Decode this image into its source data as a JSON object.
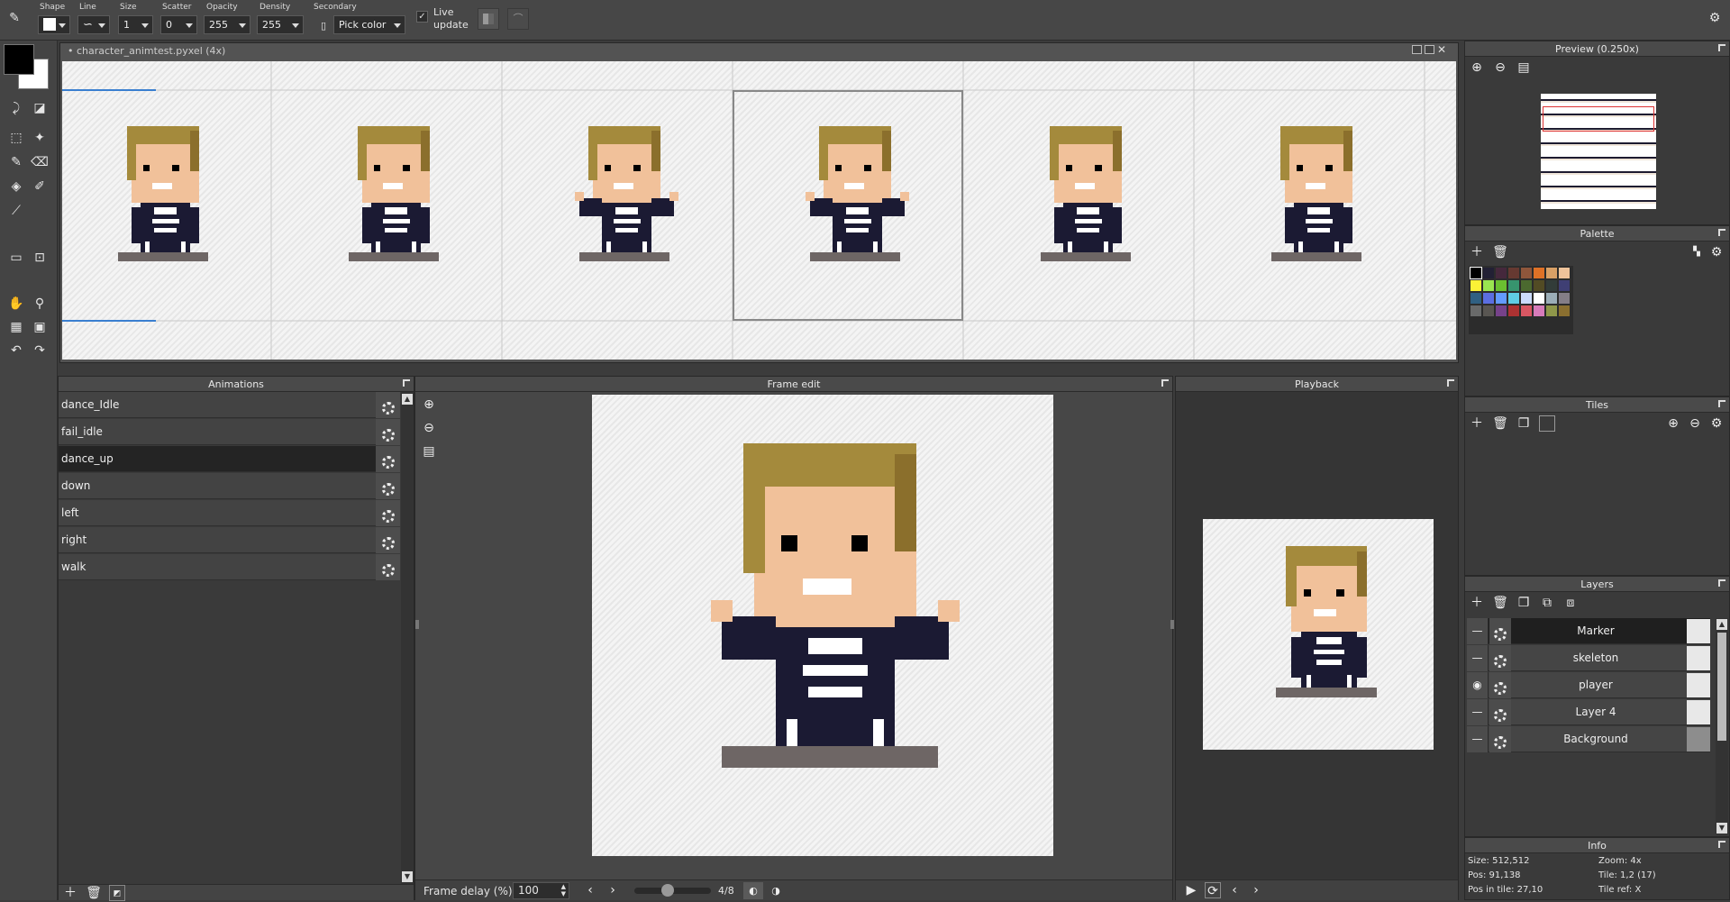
{
  "toolbar": {
    "shape_label": "Shape",
    "line_label": "Line",
    "size_label": "Size",
    "size_value": "1",
    "scatter_label": "Scatter",
    "scatter_value": "0",
    "opacity_label": "Opacity",
    "opacity_value": "255",
    "density_label": "Density",
    "density_value": "255",
    "secondary_label": "Secondary",
    "secondary_value": "Pick color",
    "live_update_line1": "Live",
    "live_update_line2": "update"
  },
  "document": {
    "title": "• character_animtest.pyxel  (4x)"
  },
  "preview": {
    "title": "Preview (0.250x)"
  },
  "palette": {
    "title": "Palette",
    "colors": [
      "#000000",
      "#222034",
      "#45283c",
      "#663931",
      "#8f563b",
      "#df7126",
      "#d9a066",
      "#eec39a",
      "#fbf236",
      "#99e550",
      "#6abe30",
      "#37946e",
      "#4b692f",
      "#524b24",
      "#323c39",
      "#3f3f74",
      "#306082",
      "#5b6ee1",
      "#639bff",
      "#5fcde4",
      "#cbdbfc",
      "#ffffff",
      "#9badb7",
      "#847e87",
      "#696a6a",
      "#595652",
      "#76428a",
      "#ac3232",
      "#d95763",
      "#d77bba",
      "#8f974a",
      "#8a6f30"
    ]
  },
  "tiles": {
    "title": "Tiles"
  },
  "layers": {
    "title": "Layers",
    "items": [
      {
        "name": "Marker"
      },
      {
        "name": "skeleton"
      },
      {
        "name": "player"
      },
      {
        "name": "Layer 4"
      },
      {
        "name": "Background"
      }
    ]
  },
  "info": {
    "title": "Info",
    "size": "Size: 512,512",
    "zoom": "Zoom: 4x",
    "pos": "Pos: 91,138",
    "tile": "Tile: 1,2 (17)",
    "pos_in_tile": "Pos in tile: 27,10",
    "tile_ref": "Tile ref: X"
  },
  "animations": {
    "title": "Animations",
    "items": [
      {
        "name": "dance_Idle"
      },
      {
        "name": "fail_idle"
      },
      {
        "name": "dance_up"
      },
      {
        "name": "down"
      },
      {
        "name": "left"
      },
      {
        "name": "right"
      },
      {
        "name": "walk"
      }
    ],
    "selected_index": 2
  },
  "frame_edit": {
    "title": "Frame edit",
    "delay_label": "Frame delay (%)",
    "delay_value": "100",
    "frame_counter": "4/8",
    "slider_fraction": 0.43
  },
  "playback": {
    "title": "Playback"
  },
  "colors": {
    "primary": "#000000",
    "secondary": "#ffffff"
  }
}
